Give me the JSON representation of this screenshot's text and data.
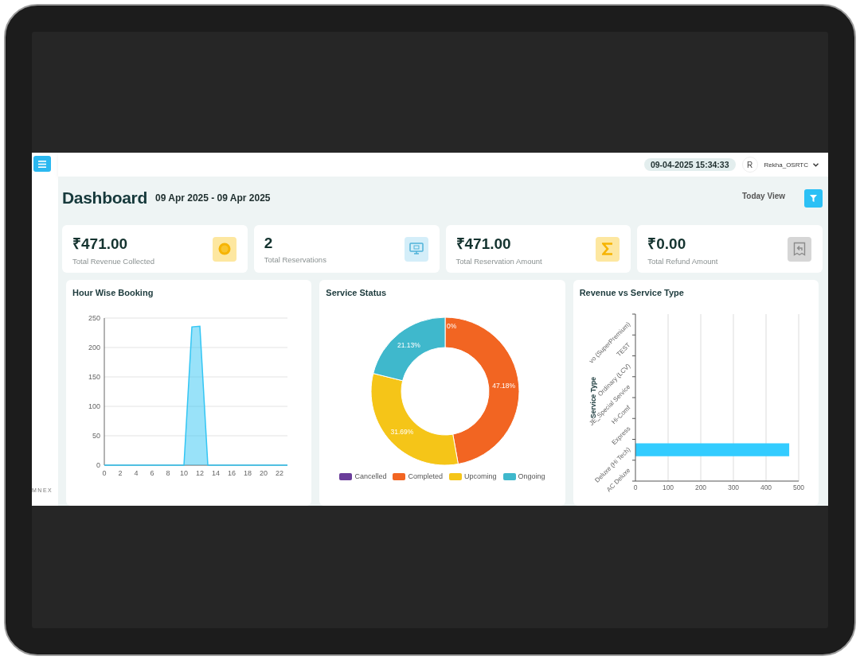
{
  "sidebar": {
    "brand": "MNEX"
  },
  "topbar": {
    "datetime": "09-04-2025 15:34:33",
    "avatar": "R",
    "user": "Rekha_OSRTC"
  },
  "header": {
    "title": "Dashboard",
    "date_range": "09 Apr 2025 - 09 Apr 2025",
    "view": "Today View"
  },
  "stats": [
    {
      "kind": "revenue",
      "value": "₹471.00",
      "label": "Total Revenue Collected"
    },
    {
      "kind": "reservations",
      "value": "2",
      "label": "Total Reservations"
    },
    {
      "kind": "amount",
      "value": "₹471.00",
      "label": "Total Reservation Amount"
    },
    {
      "kind": "refund",
      "value": "₹0.00",
      "label": "Total Refund Amount"
    }
  ],
  "hour_wise_booking": {
    "title": "Hour Wise Booking",
    "chart_data": {
      "type": "area",
      "x": [
        0,
        1,
        2,
        3,
        4,
        5,
        6,
        7,
        8,
        9,
        10,
        11,
        12,
        13,
        14,
        15,
        16,
        17,
        18,
        19,
        20,
        21,
        22,
        23
      ],
      "grid": true,
      "series": [
        {
          "color": "#33c6f4",
          "values": [
            0,
            0,
            0,
            0,
            0,
            0,
            0,
            0,
            0,
            0,
            0,
            235,
            236,
            0,
            0,
            0,
            0,
            0,
            0,
            0,
            0,
            0,
            0,
            0
          ]
        }
      ],
      "xlim": [
        0,
        23
      ],
      "ylim": [
        0,
        250
      ],
      "xticks": [
        0,
        2,
        4,
        6,
        8,
        10,
        12,
        14,
        16,
        18,
        20,
        22
      ],
      "yticks": [
        0,
        50,
        100,
        150,
        200,
        250
      ]
    }
  },
  "service_status": {
    "title": "Service Status",
    "chart_data": {
      "type": "donut",
      "series": [
        {
          "values": [
            0,
            47.18,
            31.69,
            21.13
          ]
        }
      ],
      "value_labels": [
        "0%",
        "47.18%",
        "31.69%",
        "21.13%"
      ]
    },
    "legend": [
      {
        "label": "Cancelled",
        "color": "#6a3d9a"
      },
      {
        "label": "Completed",
        "color": "#f26522"
      },
      {
        "label": "Upcoming",
        "color": "#f5c518"
      },
      {
        "label": "Ongoing",
        "color": "#3fb8cc"
      }
    ]
  },
  "revenue_vs_service_type": {
    "title": "Revenue vs Service Type",
    "chart_data": {
      "type": "bar",
      "orientation": "horizontal",
      "ylabel": "Service Type",
      "categories": [
        "vo (SuperPremium)",
        "TEST",
        "Ordinary (LCV)",
        "JE_Special Service",
        "Hi-Comf",
        "Express",
        "Deluxe (Hi Tech)",
        "AC Deluxe"
      ],
      "grid": true,
      "series": [
        {
          "color": "#33ccff",
          "values": [
            0,
            0,
            0,
            0,
            0,
            0,
            471,
            0
          ]
        }
      ],
      "xlim": [
        0,
        500
      ],
      "xticks": [
        0,
        100,
        200,
        300,
        400,
        500
      ]
    }
  }
}
